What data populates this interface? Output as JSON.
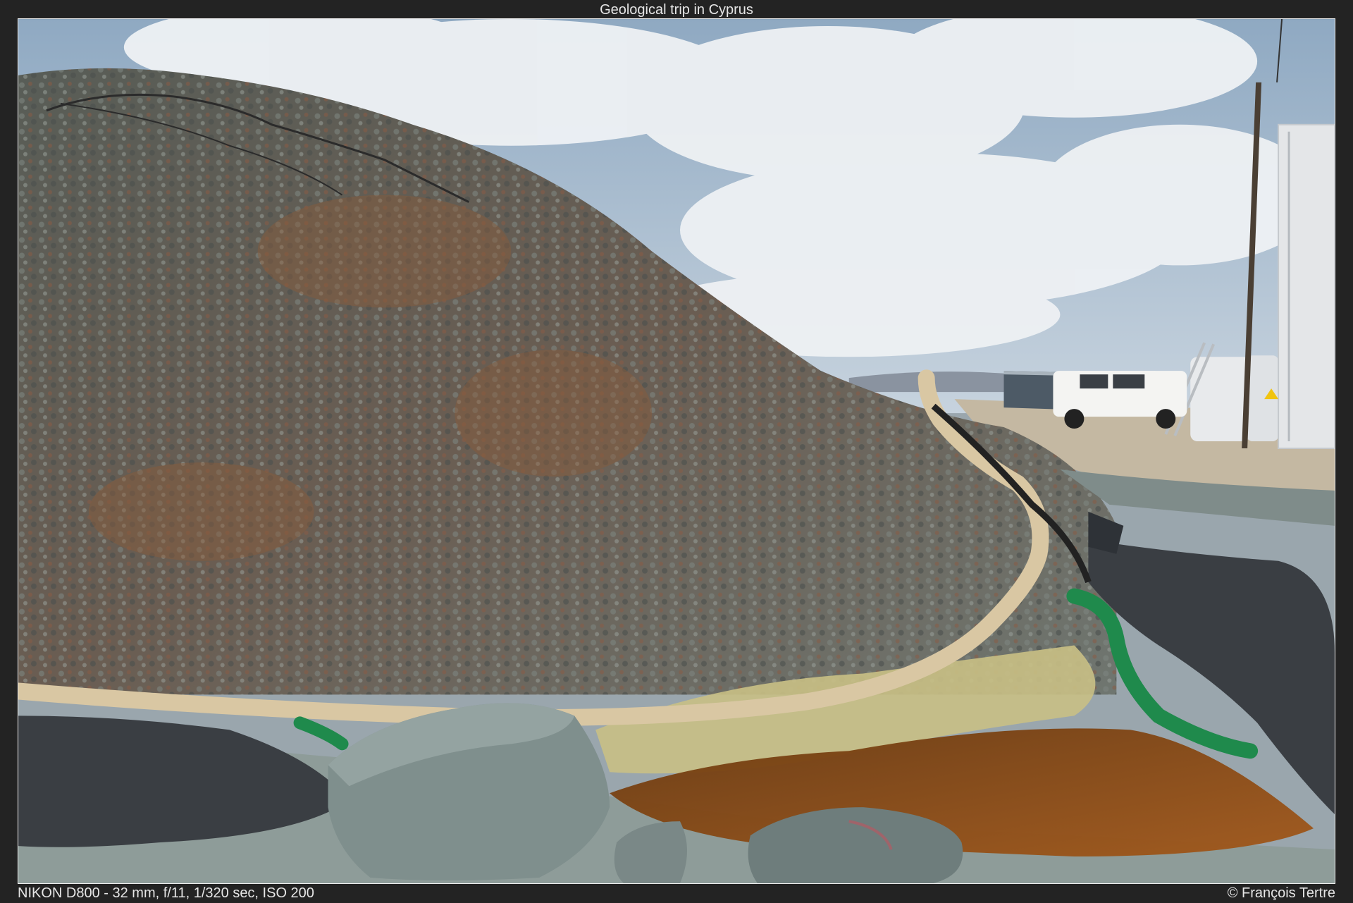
{
  "title": "Geological trip in Cyprus",
  "camera_info": "NIKON D800 - 32 mm, f/11, 1/320 sec, ISO 200",
  "copyright": "© François Tertre",
  "scene": {
    "sky_color": "#9fb7cf",
    "cloud_color": "#eef1f4",
    "ore_pile_color": "#5f655f",
    "rust_color": "#8a5a3a",
    "gravel_color": "#8e9c99",
    "liner_color": "#3a3e43",
    "puddle_color": "#8a4a12",
    "hose_beige": "#d9c7a3",
    "hose_green": "#1f8a4c",
    "vehicle_color": "#f4f4f2",
    "tank_color": "#e4e6e8"
  }
}
